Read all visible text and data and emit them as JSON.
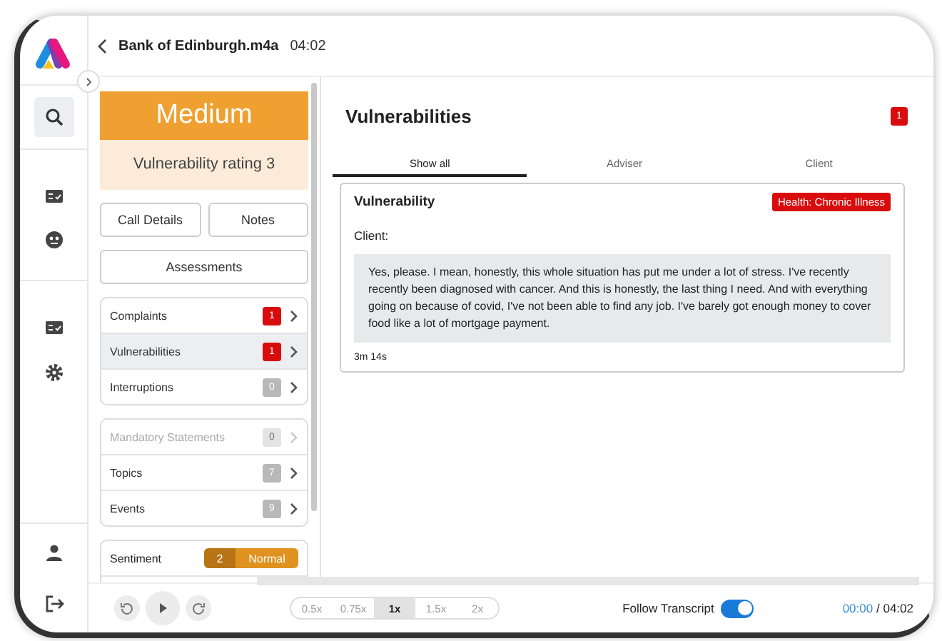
{
  "header": {
    "title": "Bank of Edinburgh.m4a",
    "duration": "04:02"
  },
  "rating": {
    "label": "Medium",
    "description": "Vulnerability rating 3"
  },
  "buttons": [
    "Call Details",
    "Notes"
  ],
  "assessments": "Assessments",
  "groups": [
    [
      {
        "label": "Complaints",
        "count": "1",
        "kind": "alert",
        "disabled": false,
        "selected": false
      },
      {
        "label": "Vulnerabilities",
        "count": "1",
        "kind": "alert",
        "disabled": false,
        "selected": true
      },
      {
        "label": "Interruptions",
        "count": "0",
        "kind": "neutral",
        "disabled": false,
        "selected": false
      }
    ],
    [
      {
        "label": "Mandatory Statements",
        "count": "0",
        "kind": "neutral",
        "disabled": true,
        "selected": false
      },
      {
        "label": "Topics",
        "count": "7",
        "kind": "neutral",
        "disabled": false,
        "selected": false
      },
      {
        "label": "Events",
        "count": "9",
        "kind": "neutral",
        "disabled": false,
        "selected": false
      }
    ]
  ],
  "sentiment": {
    "label": "Sentiment",
    "score": "2",
    "value": "Normal"
  },
  "main": {
    "title": "Vulnerabilities",
    "count": "1",
    "tabs": [
      {
        "label": "Show all",
        "selected": true
      },
      {
        "label": "Adviser",
        "selected": false
      },
      {
        "label": "Client",
        "selected": false
      }
    ],
    "card": {
      "title": "Vulnerability",
      "tag": "Health: Chronic Illness",
      "speaker": "Client:",
      "quote": "Yes, please. I mean, honestly, this whole situation has put me under a lot of stress. I've recently recently been diagnosed with cancer. And this is honestly, the last thing I need. And with everything going on because of covid, I've not been able to find any job. I've barely got enough money to cover food like a lot of mortgage payment.",
      "time": "3m 14s"
    }
  },
  "player": {
    "speeds": [
      {
        "label": "0.5x",
        "selected": false
      },
      {
        "label": "0.75x",
        "selected": false
      },
      {
        "label": "1x",
        "selected": true
      },
      {
        "label": "1.5x",
        "selected": false
      },
      {
        "label": "2x",
        "selected": false
      }
    ],
    "follow": {
      "label": "Follow Transcript",
      "on": true
    },
    "current": "00:00",
    "separator": "/",
    "total": "04:02"
  }
}
